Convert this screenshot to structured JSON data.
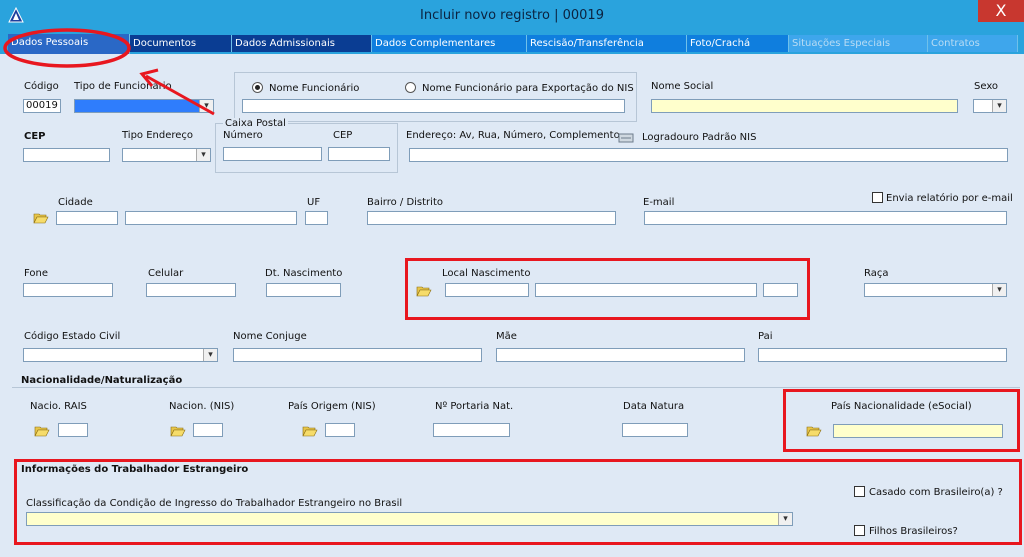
{
  "window": {
    "title": "Incluir novo registro | 00019",
    "close_glyph": "X"
  },
  "tabs": [
    {
      "label": "Dados Pessoais"
    },
    {
      "label": "Documentos"
    },
    {
      "label": "Dados Admissionais"
    },
    {
      "label": "Dados Complementares"
    },
    {
      "label": "Rescisão/Transferência"
    },
    {
      "label": "Foto/Crachá"
    },
    {
      "label": "Situações Especiais"
    },
    {
      "label": "Contratos"
    }
  ],
  "row1": {
    "codigo_label": "Código",
    "codigo_value": "00019",
    "tipo_funcionario_label": "Tipo de Funcionário",
    "radio_nome_funcionario": "Nome Funcionário",
    "radio_nome_nis": "Nome Funcionário para Exportação do NIS",
    "nome_social_label": "Nome Social",
    "sexo_label": "Sexo"
  },
  "row2": {
    "cep_label": "CEP",
    "tipo_endereco_label": "Tipo Endereço",
    "caixa_postal_label": "Caixa Postal",
    "numero_label": "Número",
    "cp_cep_label": "CEP",
    "endereco_label": "Endereço: Av, Rua, Número, Complemento",
    "logradouro_label": "Logradouro Padrão NIS"
  },
  "row3": {
    "cidade_label": "Cidade",
    "uf_label": "UF",
    "bairro_label": "Bairro / Distrito",
    "email_label": "E-mail",
    "envia_relatorio_label": "Envia relatório por e-mail"
  },
  "row4": {
    "fone_label": "Fone",
    "celular_label": "Celular",
    "dt_nascimento_label": "Dt. Nascimento",
    "local_nascimento_label": "Local Nascimento",
    "raca_label": "Raça"
  },
  "row5": {
    "estado_civil_label": "Código Estado Civil",
    "conjuge_label": "Nome Conjuge",
    "mae_label": "Mãe",
    "pai_label": "Pai"
  },
  "nacionalidade": {
    "section_label": "Nacionalidade/Naturalização",
    "nacio_rais_label": "Nacio. RAIS",
    "nacion_nis_label": "Nacion. (NIS)",
    "pais_origem_label": "País Origem (NIS)",
    "portaria_label": "Nº Portaria Nat.",
    "data_natura_label": "Data Natura",
    "pais_esocial_label": "País Nacionalidade (eSocial)"
  },
  "estrangeiro": {
    "section_label": "Informações do Trabalhador Estrangeiro",
    "classificacao_label": "Classificação da Condição de Ingresso do Trabalhador Estrangeiro no Brasil",
    "casado_label": "Casado com Brasileiro(a) ?",
    "filhos_label": "Filhos Brasileiros?"
  },
  "colors": {
    "titlebar": "#2aa3dd",
    "annotation_red": "#e8171f",
    "required_field": "#ffffcc"
  },
  "icons": [
    "app-triangle-icon",
    "folder-open-icon",
    "logradouro-icon",
    "chevron-down-icon"
  ]
}
